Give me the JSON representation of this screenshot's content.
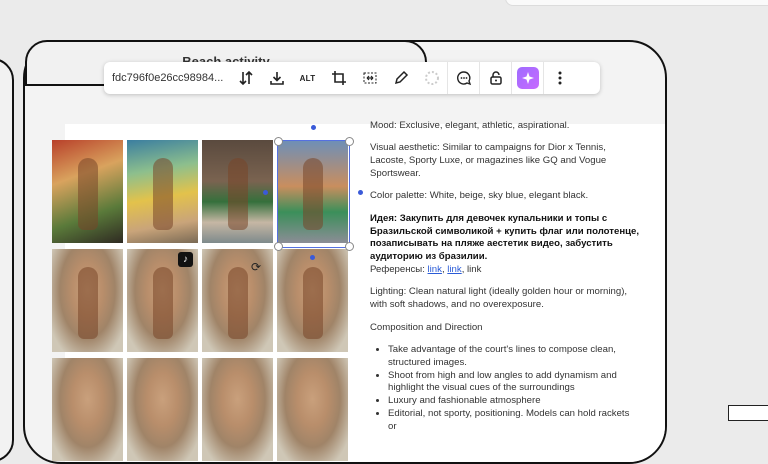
{
  "board": {
    "title": "Beach activity"
  },
  "toolbar": {
    "asset_id": "fdc796f0e26cc98984...",
    "alt_label": "ALT",
    "icons": [
      "sort-icon",
      "download-icon",
      "alt-text",
      "crop-icon",
      "fit-icon",
      "pencil-icon",
      "loading-icon",
      "comment-icon",
      "unlock-icon",
      "ai-sparkle-icon",
      "more-icon"
    ]
  },
  "text": {
    "mood": "Mood: Exclusive, elegant, athletic, aspirational.",
    "aesthetic": "Visual aesthetic: Similar to campaigns for Dior x Tennis, Lacoste, Sporty Luxe, or magazines like GQ and Vogue Sportswear.",
    "palette": "Color palette: White, beige, sky blue, elegant black.",
    "idea": "Идея: Закупить для девочек купальники и топы с Бразильской символикой + купить флаг или полотенце, позаписывать на пляже аестетик видео, забустить аудиторию из бразилии.",
    "refs_label": "Референсы: ",
    "ref1": "link",
    "ref2": "link",
    "ref3": "link",
    "sep": ", ",
    "lighting": "Lighting: Clean natural light (ideally golden hour or morning), with soft shadows, and no overexposure.",
    "composition": "Composition and Direction",
    "bullets": [
      "Take advantage of the court's lines to compose clean, structured images.",
      "Shoot from high and low angles to add dynamism and highlight the visual cues of the surroundings",
      "Luxury and fashionable atmosphere",
      "Editorial, not sporty, positioning. Models can hold rackets or"
    ]
  },
  "colors": {
    "accent": "#5570e0",
    "ai": "#a86bff"
  }
}
